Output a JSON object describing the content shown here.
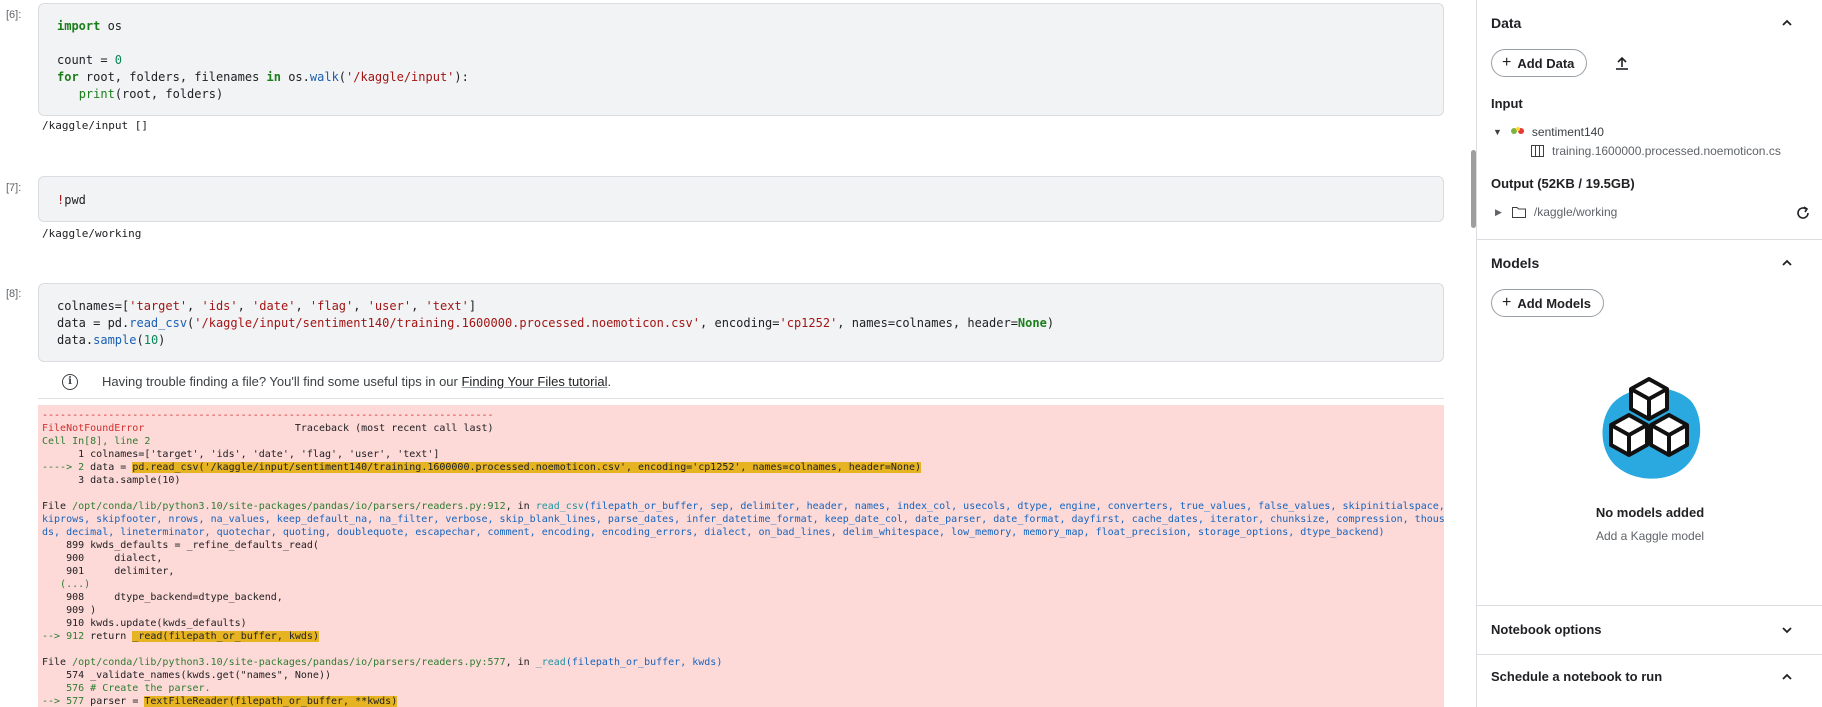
{
  "cells": [
    {
      "prompt": "[6]:",
      "code_lines": [
        "import os",
        "",
        "count = 0",
        "for root, folders, filenames in os.walk('/kaggle/input'):",
        "   print(root, folders)"
      ],
      "output": "/kaggle/input []"
    },
    {
      "prompt": "[7]:",
      "code_lines": [
        "!pwd"
      ],
      "output": "/kaggle/working"
    },
    {
      "prompt": "[8]:",
      "code_lines": [
        "colnames=['target', 'ids', 'date', 'flag', 'user', 'text']",
        "data = pd.read_csv('/kaggle/input/sentiment140/training.1600000.processed.noemoticon.csv', encoding='cp1252', names=colnames, header=None)",
        "data.sample(10)"
      ]
    }
  ],
  "tip": {
    "text": "Having trouble finding a file? You'll find some useful tips in our ",
    "link": "Finding Your Files tutorial",
    "end": "."
  },
  "traceback": {
    "dashes": "---------------------------------------------------------------------------",
    "error_name": "FileNotFoundError",
    "traceback_title": "Traceback (most recent call last)",
    "cell_ref": "Cell In[8], line 2",
    "l1": "      1 colnames=['target', 'ids', 'date', 'flag', 'user', 'text']",
    "l2_arrow": "----> 2 ",
    "l2_pre": "data = ",
    "l2_hl": "pd.read_csv('/kaggle/input/sentiment140/training.1600000.processed.noemoticon.csv', encoding='cp1252', names=colnames, header=None)",
    "l3": "      3 data.sample(10)",
    "file1_pre": "File ",
    "file1_path": "/opt/conda/lib/python3.10/site-packages/pandas/io/parsers/readers.py:912",
    "file1_in": ", in ",
    "file1_fn": "read_csv",
    "file1_sig1": "(filepath_or_buffer, sep, delimiter, header, names, index_col, usecols, dtype, engine, converters, true_values, false_values, skipinitialspace, s",
    "file1_sig2": "kiprows, skipfooter, nrows, na_values, keep_default_na, na_filter, verbose, skip_blank_lines, parse_dates, infer_datetime_format, keep_date_col, date_parser, date_format, dayfirst, cache_dates, iterator, chunksize, compression, thousan",
    "file1_sig3": "ds, decimal, lineterminator, quotechar, quoting, doublequote, escapechar, comment, encoding, encoding_errors, dialect, on_bad_lines, delim_whitespace, low_memory, memory_map, float_precision, storage_options, dtype_backend)",
    "f1_899": "    899 kwds_defaults = _refine_defaults_read(",
    "f1_900": "    900     dialect,",
    "f1_901": "    901     delimiter,",
    "f1_dots": "   (...)",
    "f1_908": "    908     dtype_backend=dtype_backend,",
    "f1_909": "    909 )",
    "f1_910": "    910 kwds.update(kwds_defaults)",
    "f1_912_arrow": "--> 912 ",
    "f1_912_pre": "return ",
    "f1_912_hl": "_read(filepath_or_buffer, kwds)",
    "file2_path": "/opt/conda/lib/python3.10/site-packages/pandas/io/parsers/readers.py:577",
    "file2_fn": "_read",
    "file2_sig": "(filepath_or_buffer, kwds)",
    "f2_574": "    574 _validate_names(kwds.get(\"names\", None))",
    "f2_576": "    576 # Create the parser.",
    "f2_577_arrow": "--> 577 ",
    "f2_577_pre": "parser = ",
    "f2_577_hl": "TextFileReader(filepath_or_buffer, **kwds)"
  },
  "panel": {
    "data_title": "Data",
    "add_data": "Add Data",
    "input_title": "Input",
    "dataset_name": "sentiment140",
    "file_name": "training.1600000.processed.noemoticon.cs",
    "output_title": "Output (52KB / 19.5GB)",
    "output_dir": "/kaggle/working",
    "models_title": "Models",
    "add_models": "Add Models",
    "no_models": "No models added",
    "add_kaggle_model": "Add a Kaggle model",
    "notebook_options": "Notebook options",
    "schedule": "Schedule a notebook to run"
  },
  "colors": {
    "error_bg": "#fdd9d7",
    "highlight": "#e6b422",
    "models_blob": "#29a9e0"
  }
}
